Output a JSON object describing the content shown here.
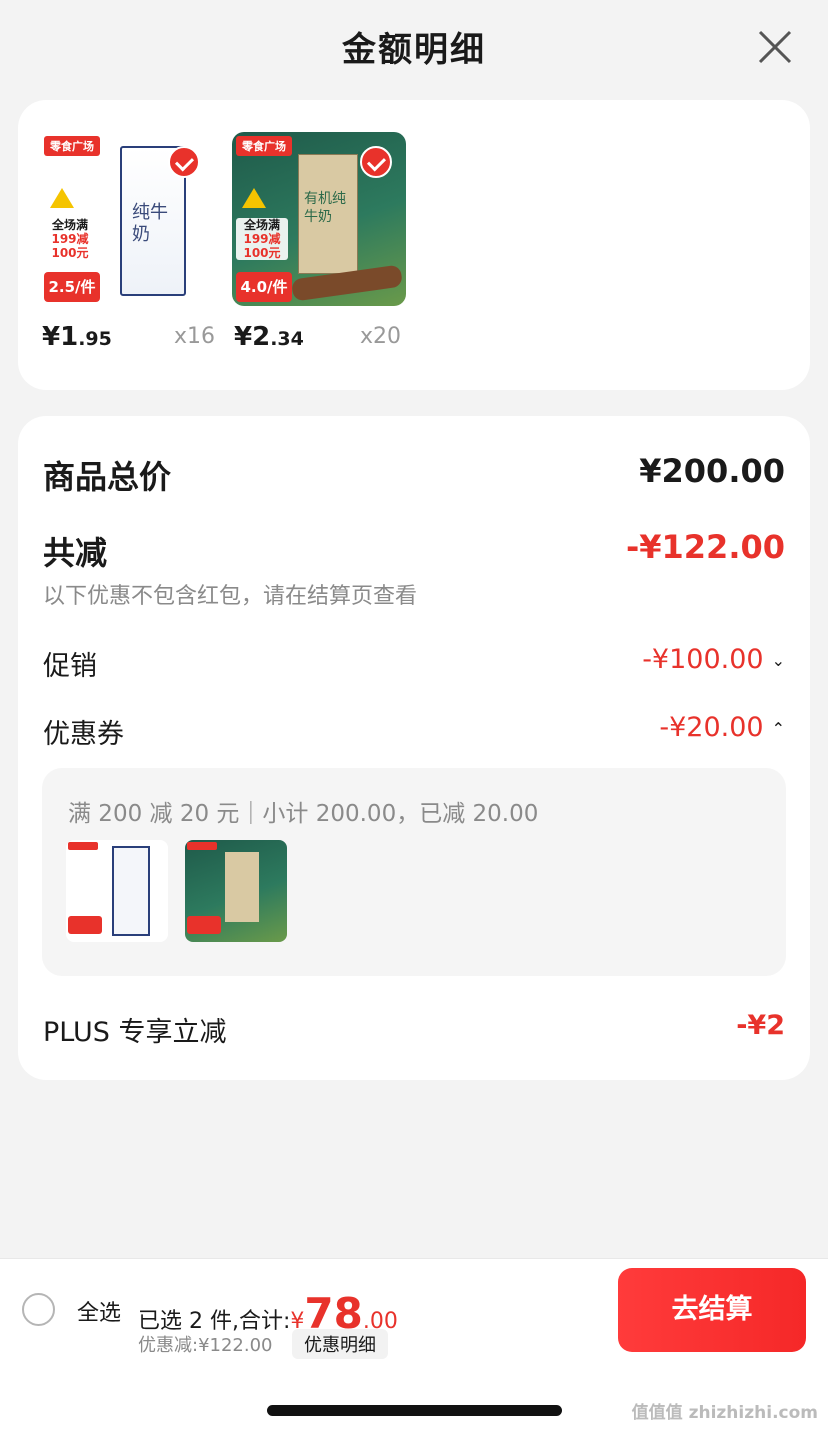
{
  "header": {
    "title": "金额明细"
  },
  "products": [
    {
      "tag": "零食广场",
      "promo_top": "全场满",
      "promo_mid": "199减",
      "promo_bot": "100元",
      "promo_price": "2.5/件",
      "pack_text": "纯牛奶",
      "price_int": "¥1",
      "price_dec": ".95",
      "qty": "x16"
    },
    {
      "tag": "零食广场",
      "promo_top": "全场满",
      "promo_mid": "199减",
      "promo_bot": "100元",
      "promo_price": "4.0/件",
      "pack_text": "有机纯牛奶",
      "price_int": "¥2",
      "price_dec": ".34",
      "qty": "x20"
    }
  ],
  "detail": {
    "goods_total_label": "商品总价",
    "goods_total_value": "¥200.00",
    "discount_label": "共减",
    "discount_value": "-¥122.00",
    "discount_note": "以下优惠不包含红包，请在结算页查看",
    "promotion_label": "促销",
    "promotion_value": "-¥100.00",
    "coupon_label": "优惠券",
    "coupon_value": "-¥20.00",
    "coupon_line": "满 200 减 20 元｜小计 200.00，已减 20.00",
    "plus_label": "PLUS 专享立减",
    "plus_value": "-¥2"
  },
  "bottom_bar": {
    "select_all": "全选",
    "summary_prefix": "已选 2 件,合计:",
    "total_symbol": "¥",
    "total_int": "78",
    "total_dec": ".00",
    "saved": "优惠减:¥122.00",
    "detail_button": "优惠明细",
    "checkout_button": "去结算"
  },
  "watermark": "值值值 zhizhizhi.com",
  "colors": {
    "accent": "#e8322b",
    "background": "#f3f3f3"
  }
}
